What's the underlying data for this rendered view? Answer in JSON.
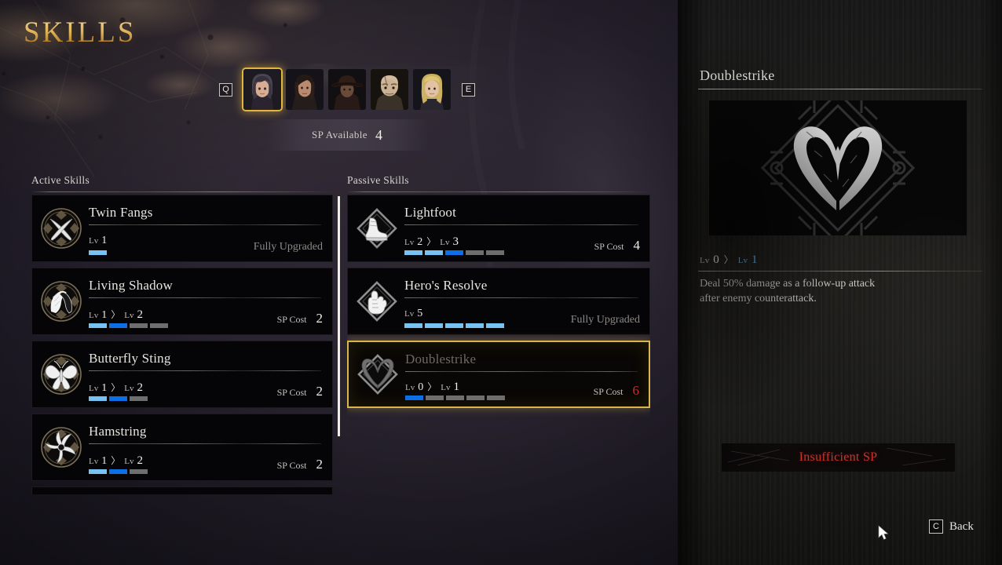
{
  "title": "SKILLS",
  "character_select": {
    "prev_key": "Q",
    "next_key": "E",
    "characters": [
      {
        "name": "dark-haired-woman",
        "selected": true
      },
      {
        "name": "long-haired-man",
        "selected": false
      },
      {
        "name": "hat-wearing-man",
        "selected": false
      },
      {
        "name": "bald-scarred-man",
        "selected": false
      },
      {
        "name": "blonde-woman",
        "selected": false
      }
    ]
  },
  "sp": {
    "label": "SP Available",
    "value": "4"
  },
  "columns": {
    "active_heading": "Active Skills",
    "passive_heading": "Passive Skills"
  },
  "labels": {
    "lv": "Lv",
    "arrow": "〉",
    "sp_cost": "SP Cost",
    "fully_upgraded": "Fully Upgraded"
  },
  "active_skills": [
    {
      "name": "Twin Fangs",
      "icon": "crossed-blades-icon",
      "current_level": "1",
      "next_level": null,
      "segments": [
        "filled"
      ],
      "status": "Fully Upgraded",
      "sp_cost": null,
      "selected": false
    },
    {
      "name": "Living Shadow",
      "icon": "shadow-profile-icon",
      "current_level": "1",
      "next_level": "2",
      "segments": [
        "filled",
        "target",
        "empty",
        "empty"
      ],
      "status": null,
      "sp_cost": "2",
      "selected": false
    },
    {
      "name": "Butterfly Sting",
      "icon": "butterfly-icon",
      "current_level": "1",
      "next_level": "2",
      "segments": [
        "filled",
        "target",
        "empty"
      ],
      "status": null,
      "sp_cost": "2",
      "selected": false
    },
    {
      "name": "Hamstring",
      "icon": "spiral-blades-icon",
      "current_level": "1",
      "next_level": "2",
      "segments": [
        "filled",
        "target",
        "empty"
      ],
      "status": null,
      "sp_cost": "2",
      "selected": false
    }
  ],
  "passive_skills": [
    {
      "name": "Lightfoot",
      "icon": "boot-icon",
      "current_level": "2",
      "next_level": "3",
      "segments": [
        "filled",
        "filled",
        "target",
        "empty",
        "empty"
      ],
      "status": null,
      "sp_cost": "4",
      "selected": false
    },
    {
      "name": "Hero's Resolve",
      "icon": "fist-icon",
      "current_level": "5",
      "next_level": null,
      "segments": [
        "filled",
        "filled",
        "filled",
        "filled",
        "filled"
      ],
      "status": "Fully Upgraded",
      "sp_cost": null,
      "selected": false
    },
    {
      "name": "Doublestrike",
      "icon": "double-blade-heart-icon",
      "current_level": "0",
      "next_level": "1",
      "segments": [
        "target",
        "empty",
        "empty",
        "empty",
        "empty"
      ],
      "status": null,
      "sp_cost": "6",
      "sp_cost_insufficient": true,
      "selected": true
    }
  ],
  "detail": {
    "title": "Doublestrike",
    "icon": "double-blade-heart-icon",
    "current_level": "0",
    "next_level": "1",
    "description": "Deal 50% damage as a follow-up attack after enemy counterattack.",
    "warning": "Insufficient SP"
  },
  "footer": {
    "back_key": "C",
    "back_label": "Back"
  },
  "colors": {
    "accent_gold": "#d9b64a",
    "level_filled": "#76c2f2",
    "level_target": "#0d6fe6",
    "level_empty": "#6e6e6e",
    "warning_red": "#c9342c"
  }
}
